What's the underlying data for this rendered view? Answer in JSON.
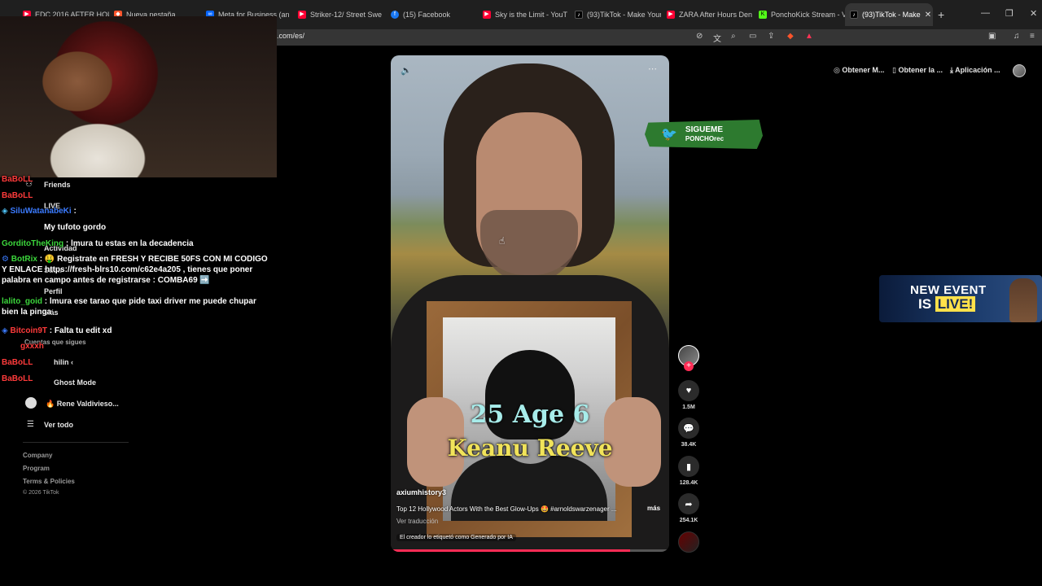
{
  "browser": {
    "tabs": [
      {
        "label": "EDC 2016 AFTER HOUR",
        "icon": "youtube-icon",
        "color": "#ff0033"
      },
      {
        "label": "Nueva pestaña",
        "icon": "brave-icon",
        "color": "#fb542b"
      },
      {
        "label": "Meta for Business (an",
        "icon": "meta-icon",
        "color": "#0866ff"
      },
      {
        "label": "Striker-12/ Street Swe",
        "icon": "youtube-icon",
        "color": "#ff0033"
      },
      {
        "label": "(15) Facebook",
        "icon": "facebook-icon",
        "color": "#1877f2"
      },
      {
        "label": "Sky is the Limit - YouT",
        "icon": "youtube-icon",
        "color": "#ff0033"
      },
      {
        "label": "(93)TikTok - Make Your",
        "icon": "tiktok-icon",
        "color": "#000000"
      },
      {
        "label": "ZARA After Hours Den",
        "icon": "youtube-icon",
        "color": "#ff0033"
      },
      {
        "label": "PonchoKick Stream - V",
        "icon": "kick-icon",
        "color": "#53fc18"
      },
      {
        "label": "(93)TikTok - Make",
        "icon": "tiktok-icon",
        "color": "#000000"
      }
    ],
    "new_tab_symbol": "+",
    "close_tab_symbol": "✕",
    "url": ".com/es/"
  },
  "chat": [
    {
      "user": "BaBoLL",
      "user_color": "#ff3b3b",
      "text": "",
      "wrap": false
    },
    {
      "user": "BaBoLL",
      "user_color": "#ff3b3b",
      "text": "",
      "wrap": false
    },
    {
      "user": "SiluWatanabeKi",
      "user_color": "#3b7bff",
      "text": " :",
      "wrap": false
    },
    {
      "user": "",
      "user_color": "#ff3b3b",
      "text": "My tufoto gordo",
      "wrap": false
    },
    {
      "user": "GorditoTheKing",
      "user_color": "#3cd63c",
      "text": " : lmura tu estas en la decadencia",
      "wrap": false
    },
    {
      "user": "BotRix",
      "user_color": "#3cd63c",
      "text": " : 🤑 Registrate en FRESH Y RECIBE 50FS CON MI CODIGO Y ENLACE https://fresh-blrs10.com/c62e4a205 , tienes que poner palabra en campo antes de registrarse : COMBA69 ➡️",
      "wrap": true
    },
    {
      "user": "lalito_goid",
      "user_color": "#3cd63c",
      "text": " : lmura ese tarao que pide taxi driver me puede chupar bien la pinga",
      "wrap": true
    },
    {
      "user": "Bitcoin9T",
      "user_color": "#ff3b3b",
      "text": " : Falta tu edit xd",
      "wrap": false
    },
    {
      "user": "gxxxh",
      "user_color": "#ff3b3b",
      "text": "",
      "wrap": false
    },
    {
      "user": "BaBoLL",
      "user_color": "#ff3b3b",
      "text": "",
      "wrap": false
    },
    {
      "user": "BaBoLL",
      "user_color": "#ff3b3b",
      "text": "",
      "wrap": false
    }
  ],
  "sidebar": {
    "friends": "Friends",
    "live": "LIVE",
    "actividad": "Actividad",
    "subir": "Subir",
    "perfil": "Perfil",
    "mas": "Más",
    "cuentas": "Cuentas que sigues",
    "account1": "hilin ‹",
    "ghost": "Ghost Mode",
    "rene": "🔥 Rene Valdivieso...",
    "ver_todo": "Ver todo",
    "footer": [
      "Company",
      "Program",
      "Terms & Policies",
      "© 2026 TikTok"
    ]
  },
  "header": {
    "btn1": "Obtener M...",
    "btn2": "Obtener la ...",
    "btn3": "Aplicación ..."
  },
  "video": {
    "age_text": "25 Age 6",
    "name_text": "Keanu Reeve",
    "author": "axiumhistory3",
    "description": "Top 12 Hollywood Actors With the Best Glow-Ups 🤩 #arnoldswarzenager ...",
    "more": "más",
    "translation": "Ver traducción",
    "ai_label": "El creador lo etiquetó como Generado por IA",
    "progress": 0.86
  },
  "actions": {
    "likes": "1.5M",
    "comments": "38.4K",
    "saves": "128.4K",
    "shares": "254.1K"
  },
  "overlays": {
    "twitter_line1": "SIGUEME",
    "twitter_line2": "PONCHOrec",
    "event_line1": "NEW EVENT",
    "event_is": "IS",
    "event_live": "LIVE!"
  }
}
